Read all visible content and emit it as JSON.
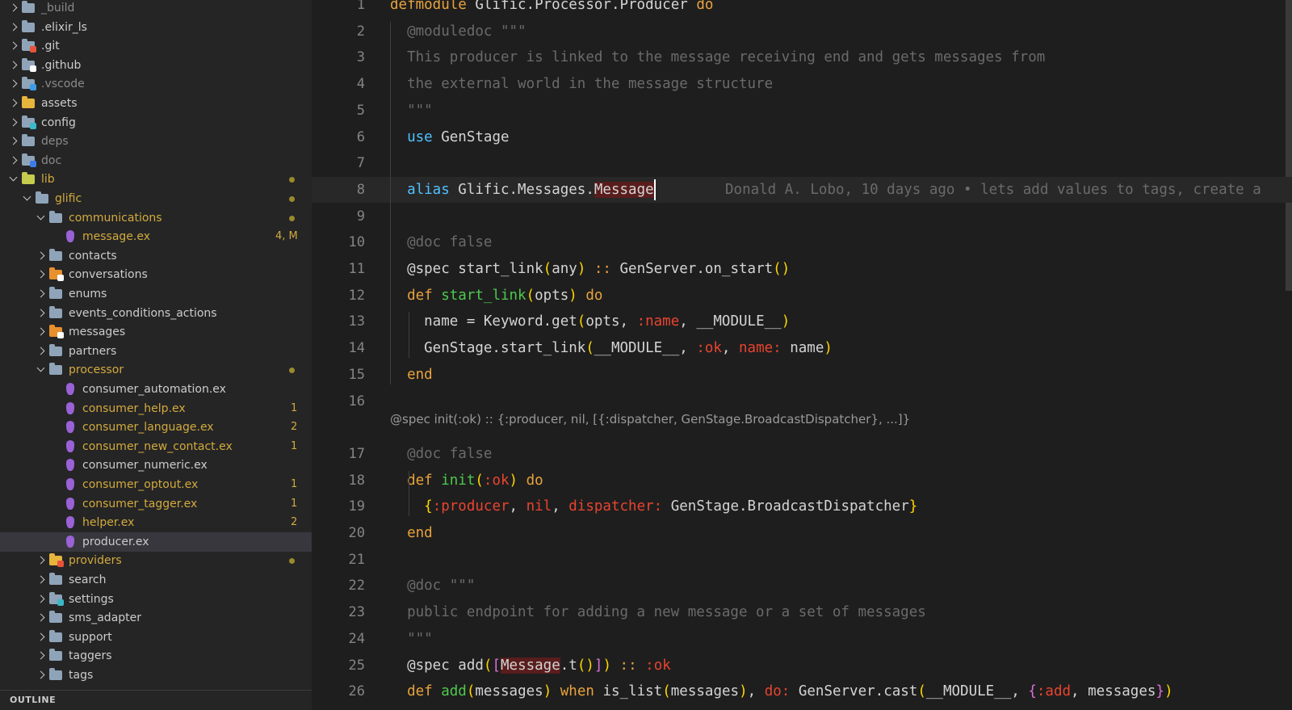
{
  "sidebar": {
    "items": [
      {
        "label": "_build",
        "state": "closed",
        "icon": "folder-icon",
        "color": "#8a8a8a"
      },
      {
        "label": ".elixir_ls",
        "state": "closed",
        "icon": "folder-icon",
        "color": "#cccccc"
      },
      {
        "label": ".git",
        "state": "closed",
        "icon": "git-folder-icon",
        "color": "#cccccc"
      },
      {
        "label": ".github",
        "state": "closed",
        "icon": "github-folder-icon",
        "color": "#cccccc"
      },
      {
        "label": ".vscode",
        "state": "closed",
        "icon": "vscode-folder-icon",
        "color": "#8a8a8a"
      },
      {
        "label": "assets",
        "state": "closed",
        "icon": "assets-folder-icon",
        "color": "#cccccc"
      },
      {
        "label": "config",
        "state": "closed",
        "icon": "config-folder-icon",
        "color": "#cccccc"
      },
      {
        "label": "deps",
        "state": "closed",
        "icon": "folder-icon",
        "color": "#8a8a8a"
      },
      {
        "label": "doc",
        "state": "closed",
        "icon": "doc-folder-icon",
        "color": "#8a8a8a"
      },
      {
        "label": "lib",
        "state": "open",
        "icon": "lib-folder-icon",
        "color": "#d2aa3c"
      },
      {
        "label": "glific",
        "state": "open",
        "icon": "folder-open-icon",
        "color": "#d2aa3c"
      },
      {
        "label": "communications",
        "state": "open",
        "icon": "folder-open-icon",
        "color": "#d2aa3c"
      },
      {
        "label": "message.ex",
        "icon": "elixir-file-icon",
        "color": "#d2aa3c",
        "count": "4, M"
      },
      {
        "label": "contacts",
        "state": "closed",
        "icon": "folder-icon",
        "color": "#cccccc"
      },
      {
        "label": "conversations",
        "state": "closed",
        "icon": "conversations-folder-icon",
        "color": "#cccccc"
      },
      {
        "label": "enums",
        "state": "closed",
        "icon": "folder-icon",
        "color": "#cccccc"
      },
      {
        "label": "events_conditions_actions",
        "state": "closed",
        "icon": "folder-icon",
        "color": "#cccccc"
      },
      {
        "label": "messages",
        "state": "closed",
        "icon": "messages-folder-icon",
        "color": "#cccccc"
      },
      {
        "label": "partners",
        "state": "closed",
        "icon": "folder-icon",
        "color": "#cccccc"
      },
      {
        "label": "processor",
        "state": "open",
        "icon": "folder-open-icon",
        "color": "#d2aa3c"
      },
      {
        "label": "consumer_automation.ex",
        "icon": "elixir-file-icon",
        "color": "#cccccc"
      },
      {
        "label": "consumer_help.ex",
        "icon": "elixir-file-icon",
        "color": "#d2aa3c",
        "count": "1"
      },
      {
        "label": "consumer_language.ex",
        "icon": "elixir-file-icon",
        "color": "#d2aa3c",
        "count": "2"
      },
      {
        "label": "consumer_new_contact.ex",
        "icon": "elixir-file-icon",
        "color": "#d2aa3c",
        "count": "1"
      },
      {
        "label": "consumer_numeric.ex",
        "icon": "elixir-file-icon",
        "color": "#cccccc"
      },
      {
        "label": "consumer_optout.ex",
        "icon": "elixir-file-icon",
        "color": "#d2aa3c",
        "count": "1"
      },
      {
        "label": "consumer_tagger.ex",
        "icon": "elixir-file-icon",
        "color": "#d2aa3c",
        "count": "1"
      },
      {
        "label": "helper.ex",
        "icon": "elixir-file-icon",
        "color": "#d2aa3c",
        "count": "2"
      },
      {
        "label": "producer.ex",
        "icon": "elixir-file-icon",
        "color": "#cccccc",
        "selected": true
      },
      {
        "label": "providers",
        "state": "closed",
        "icon": "providers-folder-icon",
        "color": "#d2aa3c"
      },
      {
        "label": "search",
        "state": "closed",
        "icon": "folder-icon",
        "color": "#cccccc"
      },
      {
        "label": "settings",
        "state": "closed",
        "icon": "settings-folder-icon",
        "color": "#cccccc"
      },
      {
        "label": "sms_adapter",
        "state": "closed",
        "icon": "folder-icon",
        "color": "#cccccc"
      },
      {
        "label": "support",
        "state": "closed",
        "icon": "folder-icon",
        "color": "#cccccc"
      },
      {
        "label": "taggers",
        "state": "closed",
        "icon": "folder-icon",
        "color": "#cccccc"
      },
      {
        "label": "tags",
        "state": "closed",
        "icon": "folder-icon",
        "color": "#cccccc"
      }
    ],
    "outline_label": "OUTLINE"
  },
  "editor": {
    "codelens": "@spec init(:ok) :: {:producer, nil, [{:dispatcher, GenStage.BroadcastDispatcher}, ...]}",
    "blame": "Donald A. Lobo, 10 days ago • lets add values to tags, create a",
    "lines": [
      {
        "n": "1",
        "tokens": [
          [
            "c-kw",
            "defmodule"
          ],
          [
            "c-mod",
            " Glific.Processor.Producer "
          ],
          [
            "c-kw",
            "do"
          ]
        ]
      },
      {
        "n": "2",
        "tokens": [
          [
            "c-com",
            "  @moduledoc \"\"\""
          ]
        ]
      },
      {
        "n": "3",
        "tokens": [
          [
            "c-com",
            "  This producer is linked to the message receiving end and gets messages from"
          ]
        ]
      },
      {
        "n": "4",
        "tokens": [
          [
            "c-com",
            "  the external world in the message structure"
          ]
        ]
      },
      {
        "n": "5",
        "tokens": [
          [
            "c-com",
            "  \"\"\""
          ]
        ]
      },
      {
        "n": "6",
        "tokens": [
          [
            "c-blue",
            "  use"
          ],
          [
            "c-mod",
            " GenStage"
          ]
        ]
      },
      {
        "n": "7",
        "tokens": []
      },
      {
        "n": "8",
        "tokens": [
          [
            "c-blue",
            "  alias"
          ],
          [
            "c-mod",
            " Glific.Messages."
          ],
          [
            "c-hl",
            "Message"
          ]
        ],
        "current": true
      },
      {
        "n": "9",
        "tokens": []
      },
      {
        "n": "10",
        "tokens": [
          [
            "c-com",
            "  @doc false"
          ]
        ]
      },
      {
        "n": "11",
        "tokens": [
          [
            "c-mod",
            "  @spec start_link"
          ],
          [
            "c-br",
            "("
          ],
          [
            "c-mod",
            "any"
          ],
          [
            "c-br",
            ")"
          ],
          [
            "c-kw",
            " ::"
          ],
          [
            "c-mod",
            " GenServer.on_start"
          ],
          [
            "c-br",
            "()"
          ]
        ]
      },
      {
        "n": "12",
        "tokens": [
          [
            "c-kw",
            "  def"
          ],
          [
            "c-fn",
            " start_link"
          ],
          [
            "c-br",
            "("
          ],
          [
            "c-mod",
            "opts"
          ],
          [
            "c-br",
            ")"
          ],
          [
            "c-kw",
            " do"
          ]
        ]
      },
      {
        "n": "13",
        "tokens": [
          [
            "c-mod",
            "    name = Keyword.get"
          ],
          [
            "c-br",
            "("
          ],
          [
            "c-mod",
            "opts, "
          ],
          [
            "c-atom",
            ":name"
          ],
          [
            "c-mod",
            ", __MODULE__"
          ],
          [
            "c-br",
            ")"
          ]
        ]
      },
      {
        "n": "14",
        "tokens": [
          [
            "c-mod",
            "    GenStage.start_link"
          ],
          [
            "c-br",
            "("
          ],
          [
            "c-mod",
            "__MODULE__, "
          ],
          [
            "c-atom",
            ":ok"
          ],
          [
            "c-mod",
            ", "
          ],
          [
            "c-atom",
            "name:"
          ],
          [
            "c-mod",
            " name"
          ],
          [
            "c-br",
            ")"
          ]
        ]
      },
      {
        "n": "15",
        "tokens": [
          [
            "c-kw",
            "  end"
          ]
        ]
      },
      {
        "n": "16",
        "tokens": []
      },
      {
        "n": "17",
        "tokens": [
          [
            "c-com",
            "  @doc false"
          ]
        ]
      },
      {
        "n": "18",
        "tokens": [
          [
            "c-kw",
            "  def"
          ],
          [
            "c-fn",
            " init"
          ],
          [
            "c-br",
            "("
          ],
          [
            "c-atom",
            ":ok"
          ],
          [
            "c-br",
            ")"
          ],
          [
            "c-kw",
            " do"
          ]
        ]
      },
      {
        "n": "19",
        "tokens": [
          [
            "c-br",
            "    {"
          ],
          [
            "c-atom",
            ":producer"
          ],
          [
            "c-mod",
            ", "
          ],
          [
            "c-atom",
            "nil"
          ],
          [
            "c-mod",
            ", "
          ],
          [
            "c-atom",
            "dispatcher:"
          ],
          [
            "c-mod",
            " GenStage.BroadcastDispatcher"
          ],
          [
            "c-br",
            "}"
          ]
        ]
      },
      {
        "n": "20",
        "tokens": [
          [
            "c-kw",
            "  end"
          ]
        ]
      },
      {
        "n": "21",
        "tokens": []
      },
      {
        "n": "22",
        "tokens": [
          [
            "c-com",
            "  @doc \"\"\""
          ]
        ]
      },
      {
        "n": "23",
        "tokens": [
          [
            "c-com",
            "  public endpoint for adding a new message or a set of messages"
          ]
        ]
      },
      {
        "n": "24",
        "tokens": [
          [
            "c-com",
            "  \"\"\""
          ]
        ]
      },
      {
        "n": "25",
        "tokens": [
          [
            "c-mod",
            "  @spec add"
          ],
          [
            "c-br",
            "("
          ],
          [
            "c-br2",
            "["
          ],
          [
            "c-hl",
            "Message"
          ],
          [
            "c-mod",
            ".t"
          ],
          [
            "c-br",
            "()"
          ],
          [
            "c-br2",
            "]"
          ],
          [
            "c-br",
            ")"
          ],
          [
            "c-kw",
            " ::"
          ],
          [
            "c-atom",
            " :ok"
          ]
        ]
      },
      {
        "n": "26",
        "tokens": [
          [
            "c-kw",
            "  def"
          ],
          [
            "c-fn",
            " add"
          ],
          [
            "c-br",
            "("
          ],
          [
            "c-mod",
            "messages"
          ],
          [
            "c-br",
            ")"
          ],
          [
            "c-kw",
            " when"
          ],
          [
            "c-mod",
            " is_list"
          ],
          [
            "c-br",
            "("
          ],
          [
            "c-mod",
            "messages"
          ],
          [
            "c-br",
            ")"
          ],
          [
            "c-mod",
            ", "
          ],
          [
            "c-atom",
            "do:"
          ],
          [
            "c-mod",
            " GenServer.cast"
          ],
          [
            "c-br",
            "("
          ],
          [
            "c-mod",
            "__MODULE__, "
          ],
          [
            "c-br2",
            "{"
          ],
          [
            "c-atom",
            ":add"
          ],
          [
            "c-mod",
            ", messages"
          ],
          [
            "c-br2",
            "}"
          ],
          [
            "c-br",
            ")"
          ]
        ]
      }
    ]
  }
}
